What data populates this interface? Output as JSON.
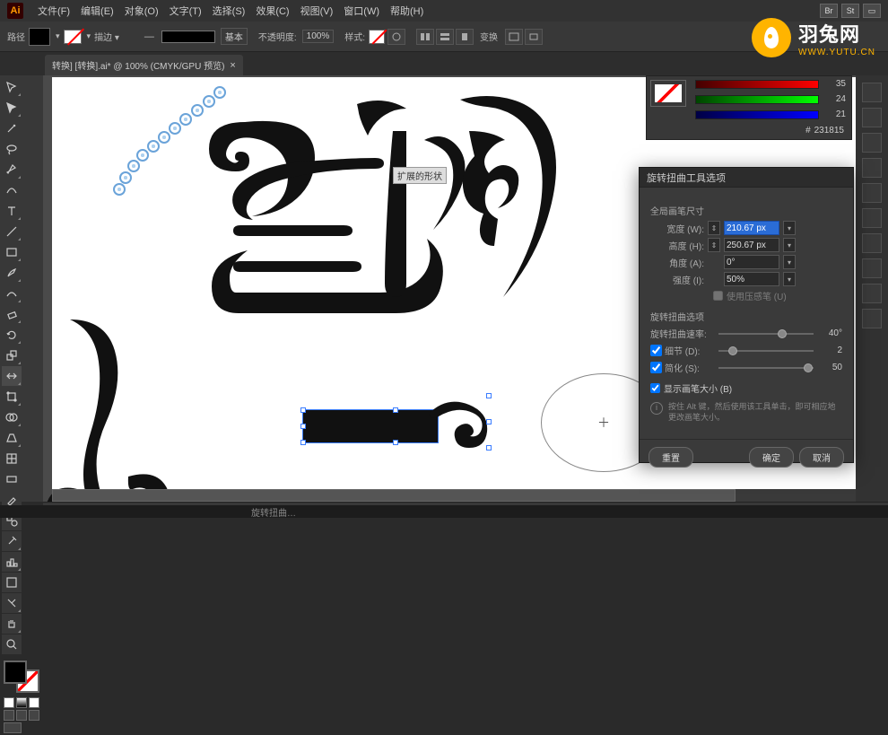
{
  "menubar": {
    "items": [
      "文件(F)",
      "编辑(E)",
      "对象(O)",
      "文字(T)",
      "选择(S)",
      "效果(C)",
      "视图(V)",
      "窗口(W)",
      "帮助(H)"
    ],
    "badges": [
      "Br",
      "St"
    ]
  },
  "options": {
    "label_left": "路径",
    "stroke_menu": "描边 ▾",
    "basic": "基本",
    "opacity_label": "不透明度:",
    "opacity_value": "100%",
    "style_label": "样式:",
    "transform_btn": "变换"
  },
  "tab": {
    "title": "转换] [转换].ai* @ 100% (CMYK/GPU 预览)"
  },
  "canvas": {
    "tooltip": "扩展的形状"
  },
  "color_panel": {
    "rows": [
      {
        "label": "",
        "value": "35",
        "grad": "linear-gradient(90deg,#400,#f00)"
      },
      {
        "label": "",
        "value": "24",
        "grad": "linear-gradient(90deg,#040,#0f0)"
      },
      {
        "label": "",
        "value": "21",
        "grad": "linear-gradient(90deg,#004,#00f)"
      }
    ],
    "hex_label": "#",
    "hex_value": "231815"
  },
  "dialog": {
    "title": "旋转扭曲工具选项",
    "section1": "全局画笔尺寸",
    "rows": [
      {
        "label": "宽度 (W):",
        "value": "210.67 px",
        "highlight": true
      },
      {
        "label": "高度 (H):",
        "value": "250.67 px",
        "highlight": false
      },
      {
        "label": "角度 (A):",
        "value": "0°",
        "highlight": false
      },
      {
        "label": "强度 (I):",
        "value": "50%",
        "highlight": false
      }
    ],
    "pressure_check": "使用压感笔 (U)",
    "section2": "旋转扭曲选项",
    "sliders": [
      {
        "label": "旋转扭曲速率:",
        "value": "40°",
        "pos": 62
      },
      {
        "label": "细节 (D):",
        "checked": true,
        "value": "2",
        "pos": 10
      },
      {
        "label": "简化 (S):",
        "checked": true,
        "value": "50",
        "pos": 90
      }
    ],
    "show_brush": "显示画笔大小 (B)",
    "hint": "按住 Alt 键，然后使用该工具单击，即可相应地更改画笔大小。",
    "btn_reset": "重置",
    "btn_ok": "确定",
    "btn_cancel": "取消"
  },
  "status": {
    "zoom": "100%",
    "strip_label": "旋转扭曲…"
  },
  "watermark": {
    "cn": "羽兔网",
    "en": "WWW.YUTU.CN"
  }
}
